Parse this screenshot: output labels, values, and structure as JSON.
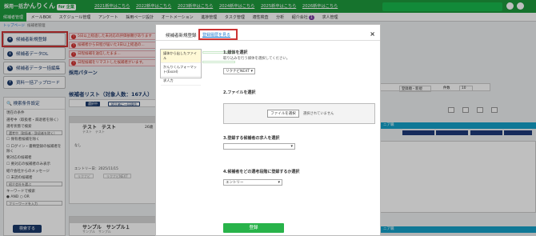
{
  "header": {
    "logo_small": "採用一括",
    "logo_main": "かんりくん",
    "logo_badge": "for 企業",
    "links": [
      "2021新卒はこちら",
      "2022新卒はこちら",
      "2023新卒はこちら",
      "2024新卒はこちら",
      "2025新卒はこちら",
      "2026新卒はこちら"
    ]
  },
  "nav": {
    "items": [
      "候補者管理",
      "メールBOX",
      "スケジュール管理",
      "アンケート",
      "採用ページ設計",
      "オートメーション",
      "進捗管理",
      "タスク管理",
      "適性検査",
      "分析",
      "紹介会社",
      "求人管理"
    ],
    "badge": "1"
  },
  "breadcrumb": {
    "first": "トップページ",
    "second": "候補者管理"
  },
  "sidebar": {
    "buttons": [
      "候補者新規登録",
      "候補者データDL",
      "候補者データ一括編集",
      "資料一括アップロード"
    ],
    "search_title": "検索条件設定",
    "lines": [
      "現在の条件",
      "選考中（取扱者・辞退者を除く）",
      "選考状態で検索",
      "選考中（取扱者・辞退者を除く）",
      "保有者候補を除く",
      "ログイン・書類登録の候補者を除く",
      "要対応の候補者",
      "要対応の候補者のみ表示",
      "紹介会社からのメッセージ",
      "未読の候補者",
      "紹介会社を選ぶ",
      "キーワードで検索",
      "AND",
      "OR",
      "フリーワードを入力"
    ],
    "search_button": "検索する"
  },
  "alerts": [
    "5日以上経過した未対応の評価依頼があります",
    "候補者から日程が届いた3日以上経過の...",
    "日程候補を送信したまま...",
    "日程候補をリマストした候補者がいます。"
  ],
  "main": {
    "pattern": "採用パターン",
    "list_title": "候補者リスト（対象人数：167人）",
    "row1_name": "テスト　テスト",
    "row1_kana": "テスト　テスト",
    "row1_age": "26歳",
    "row1_entry": "エントリー日：2025/11/15",
    "row1_status": "なし",
    "row2_name": "サンプル　サンプル１",
    "row2_kana": "サンプル　サンプル",
    "chips": [
      "選択中",
      "紹介者に一括操作",
      "LINE連携中",
      "リクナビ",
      "リクナビNEXT"
    ],
    "right_tag1": "ニア職",
    "right_tag2": "ニア職",
    "sort_label": "登録順・新規",
    "count_label": "件数",
    "count_value": "10"
  },
  "modal": {
    "title": "候補者新規登録",
    "link": "登録履歴を見る",
    "close": "×",
    "s1_title": "1.媒体を選択",
    "s1_note": "取り込みを行う媒体を選択してください。",
    "s1_value": "リクナビNEXT",
    "s2_title": "2.ファイルを選択",
    "s2_btn": "ファイルを選択",
    "s2_note": "選択されていません",
    "s3_title": "3.登録する候補者の求人を選択",
    "s4_title": "4.候補者をどの選考段階に登録するか選択",
    "s4_value": "エントリー",
    "register": "登録",
    "dropdown": [
      "媒体から出したファイル",
      "かんりくんフォーマット(Excel)",
      "求人力"
    ]
  }
}
